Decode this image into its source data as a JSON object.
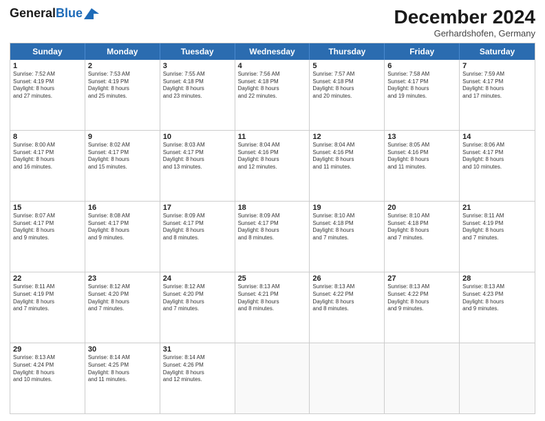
{
  "header": {
    "logo_general": "General",
    "logo_blue": "Blue",
    "month_title": "December 2024",
    "location": "Gerhardshofen, Germany"
  },
  "calendar": {
    "days": [
      "Sunday",
      "Monday",
      "Tuesday",
      "Wednesday",
      "Thursday",
      "Friday",
      "Saturday"
    ],
    "rows": [
      [
        {
          "day": "1",
          "lines": [
            "Sunrise: 7:52 AM",
            "Sunset: 4:19 PM",
            "Daylight: 8 hours",
            "and 27 minutes."
          ]
        },
        {
          "day": "2",
          "lines": [
            "Sunrise: 7:53 AM",
            "Sunset: 4:19 PM",
            "Daylight: 8 hours",
            "and 25 minutes."
          ]
        },
        {
          "day": "3",
          "lines": [
            "Sunrise: 7:55 AM",
            "Sunset: 4:18 PM",
            "Daylight: 8 hours",
            "and 23 minutes."
          ]
        },
        {
          "day": "4",
          "lines": [
            "Sunrise: 7:56 AM",
            "Sunset: 4:18 PM",
            "Daylight: 8 hours",
            "and 22 minutes."
          ]
        },
        {
          "day": "5",
          "lines": [
            "Sunrise: 7:57 AM",
            "Sunset: 4:18 PM",
            "Daylight: 8 hours",
            "and 20 minutes."
          ]
        },
        {
          "day": "6",
          "lines": [
            "Sunrise: 7:58 AM",
            "Sunset: 4:17 PM",
            "Daylight: 8 hours",
            "and 19 minutes."
          ]
        },
        {
          "day": "7",
          "lines": [
            "Sunrise: 7:59 AM",
            "Sunset: 4:17 PM",
            "Daylight: 8 hours",
            "and 17 minutes."
          ]
        }
      ],
      [
        {
          "day": "8",
          "lines": [
            "Sunrise: 8:00 AM",
            "Sunset: 4:17 PM",
            "Daylight: 8 hours",
            "and 16 minutes."
          ]
        },
        {
          "day": "9",
          "lines": [
            "Sunrise: 8:02 AM",
            "Sunset: 4:17 PM",
            "Daylight: 8 hours",
            "and 15 minutes."
          ]
        },
        {
          "day": "10",
          "lines": [
            "Sunrise: 8:03 AM",
            "Sunset: 4:17 PM",
            "Daylight: 8 hours",
            "and 13 minutes."
          ]
        },
        {
          "day": "11",
          "lines": [
            "Sunrise: 8:04 AM",
            "Sunset: 4:16 PM",
            "Daylight: 8 hours",
            "and 12 minutes."
          ]
        },
        {
          "day": "12",
          "lines": [
            "Sunrise: 8:04 AM",
            "Sunset: 4:16 PM",
            "Daylight: 8 hours",
            "and 11 minutes."
          ]
        },
        {
          "day": "13",
          "lines": [
            "Sunrise: 8:05 AM",
            "Sunset: 4:16 PM",
            "Daylight: 8 hours",
            "and 11 minutes."
          ]
        },
        {
          "day": "14",
          "lines": [
            "Sunrise: 8:06 AM",
            "Sunset: 4:17 PM",
            "Daylight: 8 hours",
            "and 10 minutes."
          ]
        }
      ],
      [
        {
          "day": "15",
          "lines": [
            "Sunrise: 8:07 AM",
            "Sunset: 4:17 PM",
            "Daylight: 8 hours",
            "and 9 minutes."
          ]
        },
        {
          "day": "16",
          "lines": [
            "Sunrise: 8:08 AM",
            "Sunset: 4:17 PM",
            "Daylight: 8 hours",
            "and 9 minutes."
          ]
        },
        {
          "day": "17",
          "lines": [
            "Sunrise: 8:09 AM",
            "Sunset: 4:17 PM",
            "Daylight: 8 hours",
            "and 8 minutes."
          ]
        },
        {
          "day": "18",
          "lines": [
            "Sunrise: 8:09 AM",
            "Sunset: 4:17 PM",
            "Daylight: 8 hours",
            "and 8 minutes."
          ]
        },
        {
          "day": "19",
          "lines": [
            "Sunrise: 8:10 AM",
            "Sunset: 4:18 PM",
            "Daylight: 8 hours",
            "and 7 minutes."
          ]
        },
        {
          "day": "20",
          "lines": [
            "Sunrise: 8:10 AM",
            "Sunset: 4:18 PM",
            "Daylight: 8 hours",
            "and 7 minutes."
          ]
        },
        {
          "day": "21",
          "lines": [
            "Sunrise: 8:11 AM",
            "Sunset: 4:19 PM",
            "Daylight: 8 hours",
            "and 7 minutes."
          ]
        }
      ],
      [
        {
          "day": "22",
          "lines": [
            "Sunrise: 8:11 AM",
            "Sunset: 4:19 PM",
            "Daylight: 8 hours",
            "and 7 minutes."
          ]
        },
        {
          "day": "23",
          "lines": [
            "Sunrise: 8:12 AM",
            "Sunset: 4:20 PM",
            "Daylight: 8 hours",
            "and 7 minutes."
          ]
        },
        {
          "day": "24",
          "lines": [
            "Sunrise: 8:12 AM",
            "Sunset: 4:20 PM",
            "Daylight: 8 hours",
            "and 7 minutes."
          ]
        },
        {
          "day": "25",
          "lines": [
            "Sunrise: 8:13 AM",
            "Sunset: 4:21 PM",
            "Daylight: 8 hours",
            "and 8 minutes."
          ]
        },
        {
          "day": "26",
          "lines": [
            "Sunrise: 8:13 AM",
            "Sunset: 4:22 PM",
            "Daylight: 8 hours",
            "and 8 minutes."
          ]
        },
        {
          "day": "27",
          "lines": [
            "Sunrise: 8:13 AM",
            "Sunset: 4:22 PM",
            "Daylight: 8 hours",
            "and 9 minutes."
          ]
        },
        {
          "day": "28",
          "lines": [
            "Sunrise: 8:13 AM",
            "Sunset: 4:23 PM",
            "Daylight: 8 hours",
            "and 9 minutes."
          ]
        }
      ],
      [
        {
          "day": "29",
          "lines": [
            "Sunrise: 8:13 AM",
            "Sunset: 4:24 PM",
            "Daylight: 8 hours",
            "and 10 minutes."
          ]
        },
        {
          "day": "30",
          "lines": [
            "Sunrise: 8:14 AM",
            "Sunset: 4:25 PM",
            "Daylight: 8 hours",
            "and 11 minutes."
          ]
        },
        {
          "day": "31",
          "lines": [
            "Sunrise: 8:14 AM",
            "Sunset: 4:26 PM",
            "Daylight: 8 hours",
            "and 12 minutes."
          ]
        },
        null,
        null,
        null,
        null
      ]
    ]
  }
}
